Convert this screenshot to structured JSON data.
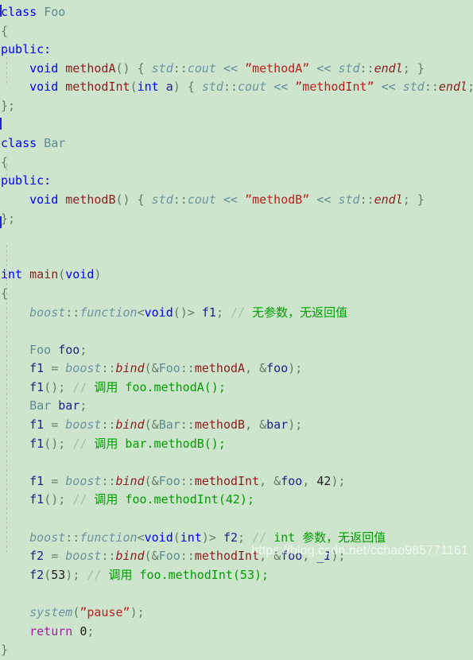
{
  "editor": {
    "background_color": "#cde5cc",
    "language": "cpp",
    "colors": {
      "keyword": "#0000ff",
      "return_keyword": "#a020a0",
      "user_type": "#5f8a93",
      "function": "#8b2020",
      "variable": "#20208b",
      "namespace": "#6d93a0",
      "string": "#bb2020",
      "comment": "#00a000",
      "comment_slashes": "#9ec49e",
      "punctuation": "#607d6a",
      "number": "#1a1a1a"
    }
  },
  "code": {
    "line_01": {
      "kw_class": "class",
      "type_foo": "Foo"
    },
    "line_02": {
      "brace_open": "{"
    },
    "line_03": {
      "kw_public": "public:"
    },
    "line_04": {
      "kw_void": "void",
      "fn_name": "methodA",
      "parens": "()",
      "brace_open": "{",
      "ns_std": "std",
      "scope": "::",
      "member_cout": "cout",
      "shift": "<<",
      "string": "”methodA”",
      "shift2": "<<",
      "ns_std2": "std",
      "scope2": "::",
      "member_endl": "endl",
      "semi": ";",
      "brace_close": "}"
    },
    "line_05": {
      "kw_void": "void",
      "fn_name": "methodInt",
      "paren_open": "(",
      "kw_int": "int",
      "param": "a",
      "paren_close": ")",
      "brace_open": "{",
      "ns_std": "std",
      "scope": "::",
      "member_cout": "cout",
      "shift": "<<",
      "string": "”methodInt”",
      "shift2": "<<",
      "ns_std2": "std",
      "scope2": "::",
      "member_endl": "endl",
      "semi": ";",
      "brace_close": "}"
    },
    "line_06": {
      "brace_close": "};"
    },
    "line_07": {
      "blank": ""
    },
    "line_08": {
      "kw_class": "class",
      "type_bar": "Bar"
    },
    "line_09": {
      "brace_open": "{"
    },
    "line_10": {
      "kw_public": "public:"
    },
    "line_11": {
      "kw_void": "void",
      "fn_name": "methodB",
      "parens": "()",
      "brace_open": "{",
      "ns_std": "std",
      "scope": "::",
      "member_cout": "cout",
      "shift": "<<",
      "string": "”methodB”",
      "shift2": "<<",
      "ns_std2": "std",
      "scope2": "::",
      "member_endl": "endl",
      "semi": ";",
      "brace_close": "}"
    },
    "line_12": {
      "brace_close": "};"
    },
    "line_13": {
      "blank": ""
    },
    "line_14": {
      "blank": ""
    },
    "line_15": {
      "kw_int": "int",
      "fn_main": "main",
      "paren_open": "(",
      "kw_void": "void",
      "paren_close": ")"
    },
    "line_16": {
      "brace_open": "{"
    },
    "line_17": {
      "ns_boost": "boost",
      "scope": "::",
      "tpl_function": "function",
      "angle_open": "<",
      "kw_void": "void",
      "parens": "()",
      "angle_close": ">",
      "var_f1": "f1",
      "semi": ";",
      "cmt_slashes": "//",
      "comment": "无参数，无返回值"
    },
    "line_18": {
      "blank": ""
    },
    "line_19": {
      "type_foo": "Foo",
      "var_foo": "foo",
      "semi": ";"
    },
    "line_20": {
      "var_f1": "f1",
      "eq": "=",
      "ns_boost": "boost",
      "scope": "::",
      "fn_bind": "bind",
      "paren_open": "(",
      "amp": "&",
      "type_foo": "Foo",
      "scope2": "::",
      "method": "methodA",
      "comma": ",",
      "amp2": "&",
      "var_foo": "foo",
      "paren_close": ")",
      "semi": ";"
    },
    "line_21": {
      "var_f1": "f1",
      "parens": "()",
      "semi": ";",
      "cmt_slashes": "//",
      "comment": "调用 foo.methodA();"
    },
    "line_22": {
      "type_bar": "Bar",
      "var_bar": "bar",
      "semi": ";"
    },
    "line_23": {
      "var_f1": "f1",
      "eq": "=",
      "ns_boost": "boost",
      "scope": "::",
      "fn_bind": "bind",
      "paren_open": "(",
      "amp": "&",
      "type_bar": "Bar",
      "scope2": "::",
      "method": "methodB",
      "comma": ",",
      "amp2": "&",
      "var_bar": "bar",
      "paren_close": ")",
      "semi": ";"
    },
    "line_24": {
      "var_f1": "f1",
      "parens": "()",
      "semi": ";",
      "cmt_slashes": "//",
      "comment": "调用 bar.methodB();"
    },
    "line_25": {
      "blank": ""
    },
    "line_26": {
      "var_f1": "f1",
      "eq": "=",
      "ns_boost": "boost",
      "scope": "::",
      "fn_bind": "bind",
      "paren_open": "(",
      "amp": "&",
      "type_foo": "Foo",
      "scope2": "::",
      "method": "methodInt",
      "comma": ",",
      "amp2": "&",
      "var_foo": "foo",
      "comma2": ",",
      "num": "42",
      "paren_close": ")",
      "semi": ";"
    },
    "line_27": {
      "var_f1": "f1",
      "parens": "()",
      "semi": ";",
      "cmt_slashes": "//",
      "comment": "调用 foo.methodInt(42);"
    },
    "line_28": {
      "blank": ""
    },
    "line_29": {
      "ns_boost": "boost",
      "scope": "::",
      "tpl_function": "function",
      "angle_open": "<",
      "kw_void": "void",
      "paren_open": "(",
      "kw_int": "int",
      "paren_close": ")",
      "angle_close": ">",
      "var_f2": "f2",
      "semi": ";",
      "cmt_slashes": "//",
      "comment": "int 参数，无返回值"
    },
    "line_30": {
      "var_f2": "f2",
      "eq": "=",
      "ns_boost": "boost",
      "scope": "::",
      "fn_bind": "bind",
      "paren_open": "(",
      "amp": "&",
      "type_foo": "Foo",
      "scope2": "::",
      "method": "methodInt",
      "comma": ",",
      "amp2": "&",
      "var_foo": "foo",
      "comma2": ",",
      "placeholder": "_1",
      "paren_close": ")",
      "semi": ";"
    },
    "line_31": {
      "var_f2": "f2",
      "paren_open": "(",
      "num": "53",
      "paren_close": ")",
      "semi": ";",
      "cmt_slashes": "//",
      "comment": "调用 foo.methodInt(53);"
    },
    "line_32": {
      "blank": ""
    },
    "line_33": {
      "fn_system": "system",
      "paren_open": "(",
      "string": "”pause”",
      "paren_close": ")",
      "semi": ";"
    },
    "line_34": {
      "kw_return": "return",
      "num": "0",
      "semi": ";"
    },
    "line_35": {
      "brace_close": "}"
    }
  },
  "watermark": {
    "text": "https://blog.csdn.net/cchao985771161"
  }
}
